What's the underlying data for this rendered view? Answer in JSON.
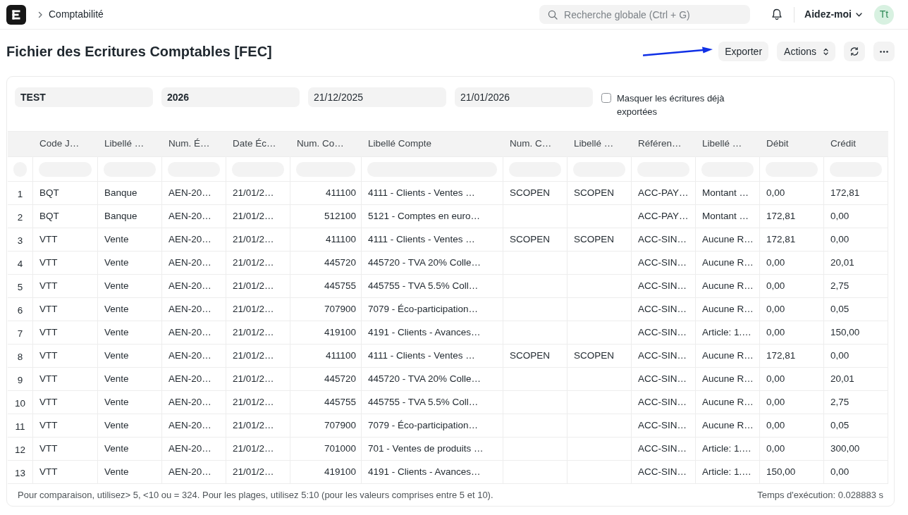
{
  "navbar": {
    "breadcrumb": [
      "Comptabilité"
    ],
    "search": {
      "placeholder": "Recherche globale (Ctrl + G)"
    },
    "help_menu": "Aidez-moi",
    "avatar": "Tt"
  },
  "page": {
    "title": "Fichier des Ecritures Comptables [FEC]",
    "buttons": [
      {
        "kind": "plain",
        "label": "Exporter"
      },
      {
        "kind": "menu",
        "label": "Actions"
      },
      {
        "kind": "refresh"
      },
      {
        "kind": "more"
      }
    ]
  },
  "filters": [
    {
      "kind": "link",
      "value": "TEST"
    },
    {
      "kind": "link",
      "value": "2026"
    },
    {
      "kind": "date",
      "value": "21/12/2025"
    },
    {
      "kind": "date",
      "value": "21/01/2026"
    }
  ],
  "checkbox_filter": {
    "label": "Masquer les écritures déjà exportées",
    "checked": false
  },
  "table": {
    "columns": [
      {
        "label": "Code J…",
        "right_aligned": false
      },
      {
        "label": "Libellé …",
        "right_aligned": false
      },
      {
        "label": "Num. É…",
        "right_aligned": false
      },
      {
        "label": "Date Éc…",
        "right_aligned": false
      },
      {
        "label": "Num. Co…",
        "right_aligned": true
      },
      {
        "label": "Libellé Compte",
        "right_aligned": false
      },
      {
        "label": "Num. C…",
        "right_aligned": false
      },
      {
        "label": "Libellé …",
        "right_aligned": false
      },
      {
        "label": "Référen…",
        "right_aligned": false
      },
      {
        "label": "Libellé …",
        "right_aligned": false
      },
      {
        "label": "Débit",
        "right_aligned": false
      },
      {
        "label": "Crédit",
        "right_aligned": false
      }
    ],
    "rows": [
      {
        "index": "1",
        "cells": [
          "BQT",
          "Banque",
          "AEN-20…",
          "21/01/2…",
          "411100",
          "4111 - Clients - Ventes …",
          "SCOPEN",
          "SCOPEN",
          "ACC-PAY…",
          "Montant …",
          "0,00",
          "172,81"
        ]
      },
      {
        "index": "2",
        "cells": [
          "BQT",
          "Banque",
          "AEN-20…",
          "21/01/2…",
          "512100",
          "5121 - Comptes en euro…",
          null,
          null,
          "ACC-PAY…",
          "Montant …",
          "172,81",
          "0,00"
        ]
      },
      {
        "index": "3",
        "cells": [
          "VTT",
          "Vente",
          "AEN-20…",
          "21/01/2…",
          "411100",
          "4111 - Clients - Ventes …",
          "SCOPEN",
          "SCOPEN",
          "ACC-SIN…",
          "Aucune R…",
          "172,81",
          "0,00"
        ]
      },
      {
        "index": "4",
        "cells": [
          "VTT",
          "Vente",
          "AEN-20…",
          "21/01/2…",
          "445720",
          "445720 - TVA 20% Colle…",
          null,
          null,
          "ACC-SIN…",
          "Aucune R…",
          "0,00",
          "20,01"
        ]
      },
      {
        "index": "5",
        "cells": [
          "VTT",
          "Vente",
          "AEN-20…",
          "21/01/2…",
          "445755",
          "445755 - TVA 5.5% Coll…",
          null,
          null,
          "ACC-SIN…",
          "Aucune R…",
          "0,00",
          "2,75"
        ]
      },
      {
        "index": "6",
        "cells": [
          "VTT",
          "Vente",
          "AEN-20…",
          "21/01/2…",
          "707900",
          "7079 - Éco-participation…",
          null,
          null,
          "ACC-SIN…",
          "Aucune R…",
          "0,00",
          "0,05"
        ]
      },
      {
        "index": "7",
        "cells": [
          "VTT",
          "Vente",
          "AEN-20…",
          "21/01/2…",
          "419100",
          "4191 - Clients - Avances…",
          null,
          null,
          "ACC-SIN…",
          "Article: 1.…",
          "0,00",
          "150,00"
        ]
      },
      {
        "index": "8",
        "cells": [
          "VTT",
          "Vente",
          "AEN-20…",
          "21/01/2…",
          "411100",
          "4111 - Clients - Ventes …",
          "SCOPEN",
          "SCOPEN",
          "ACC-SIN…",
          "Aucune R…",
          "172,81",
          "0,00"
        ]
      },
      {
        "index": "9",
        "cells": [
          "VTT",
          "Vente",
          "AEN-20…",
          "21/01/2…",
          "445720",
          "445720 - TVA 20% Colle…",
          null,
          null,
          "ACC-SIN…",
          "Aucune R…",
          "0,00",
          "20,01"
        ]
      },
      {
        "index": "10",
        "cells": [
          "VTT",
          "Vente",
          "AEN-20…",
          "21/01/2…",
          "445755",
          "445755 - TVA 5.5% Coll…",
          null,
          null,
          "ACC-SIN…",
          "Aucune R…",
          "0,00",
          "2,75"
        ]
      },
      {
        "index": "11",
        "cells": [
          "VTT",
          "Vente",
          "AEN-20…",
          "21/01/2…",
          "707900",
          "7079 - Éco-participation…",
          null,
          null,
          "ACC-SIN…",
          "Aucune R…",
          "0,00",
          "0,05"
        ]
      },
      {
        "index": "12",
        "cells": [
          "VTT",
          "Vente",
          "AEN-20…",
          "21/01/2…",
          "701000",
          "701 - Ventes de produits …",
          null,
          null,
          "ACC-SIN…",
          "Article: 1.…",
          "0,00",
          "300,00"
        ]
      },
      {
        "index": "13",
        "cells": [
          "VTT",
          "Vente",
          "AEN-20…",
          "21/01/2…",
          "419100",
          "4191 - Clients - Avances…",
          null,
          null,
          "ACC-SIN…",
          "Article: 1.…",
          "150,00",
          "0,00"
        ]
      }
    ]
  },
  "footer": {
    "hint": "Pour comparaison, utilisez> 5, <10 ou = 324. Pour les plages, utilisez 5:10 (pour les valeurs comprises entre 5 et 10).",
    "timing": "Temps d'exécution: 0.028883 s"
  }
}
